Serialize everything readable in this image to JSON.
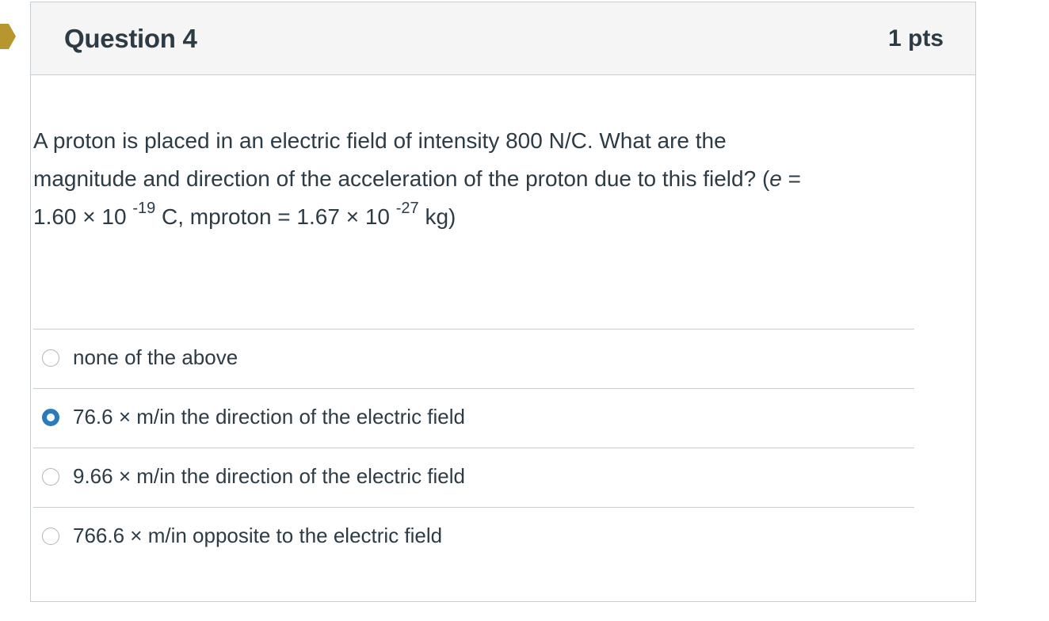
{
  "question": {
    "title": "Question 4",
    "points": "1 pts",
    "text_line1": "A proton is placed in an electric field of intensity 800 N/C. What are the",
    "text_line2_a": "magnitude and direction of the acceleration of the proton due to this field? (",
    "text_line2_e": "e",
    "text_line2_b": " =",
    "text_line3_a": "1.60 × 10 ",
    "exp1": "-19",
    "text_line3_b": " C, mproton = 1.67 × 10 ",
    "exp2": "-27",
    "text_line3_c": " kg)"
  },
  "answers": [
    {
      "label": "none of the above",
      "selected": false
    },
    {
      "label": "76.6 × m/in the direction of the electric field",
      "selected": true
    },
    {
      "label": "9.66 × m/in the direction of the electric field",
      "selected": false
    },
    {
      "label": "766.6 × m/in opposite to the electric field",
      "selected": false
    }
  ],
  "colors": {
    "marker": "#b8962e",
    "radio_selected": "#2b7abc",
    "header_bg": "#f5f5f5",
    "text": "#2d3b45"
  }
}
